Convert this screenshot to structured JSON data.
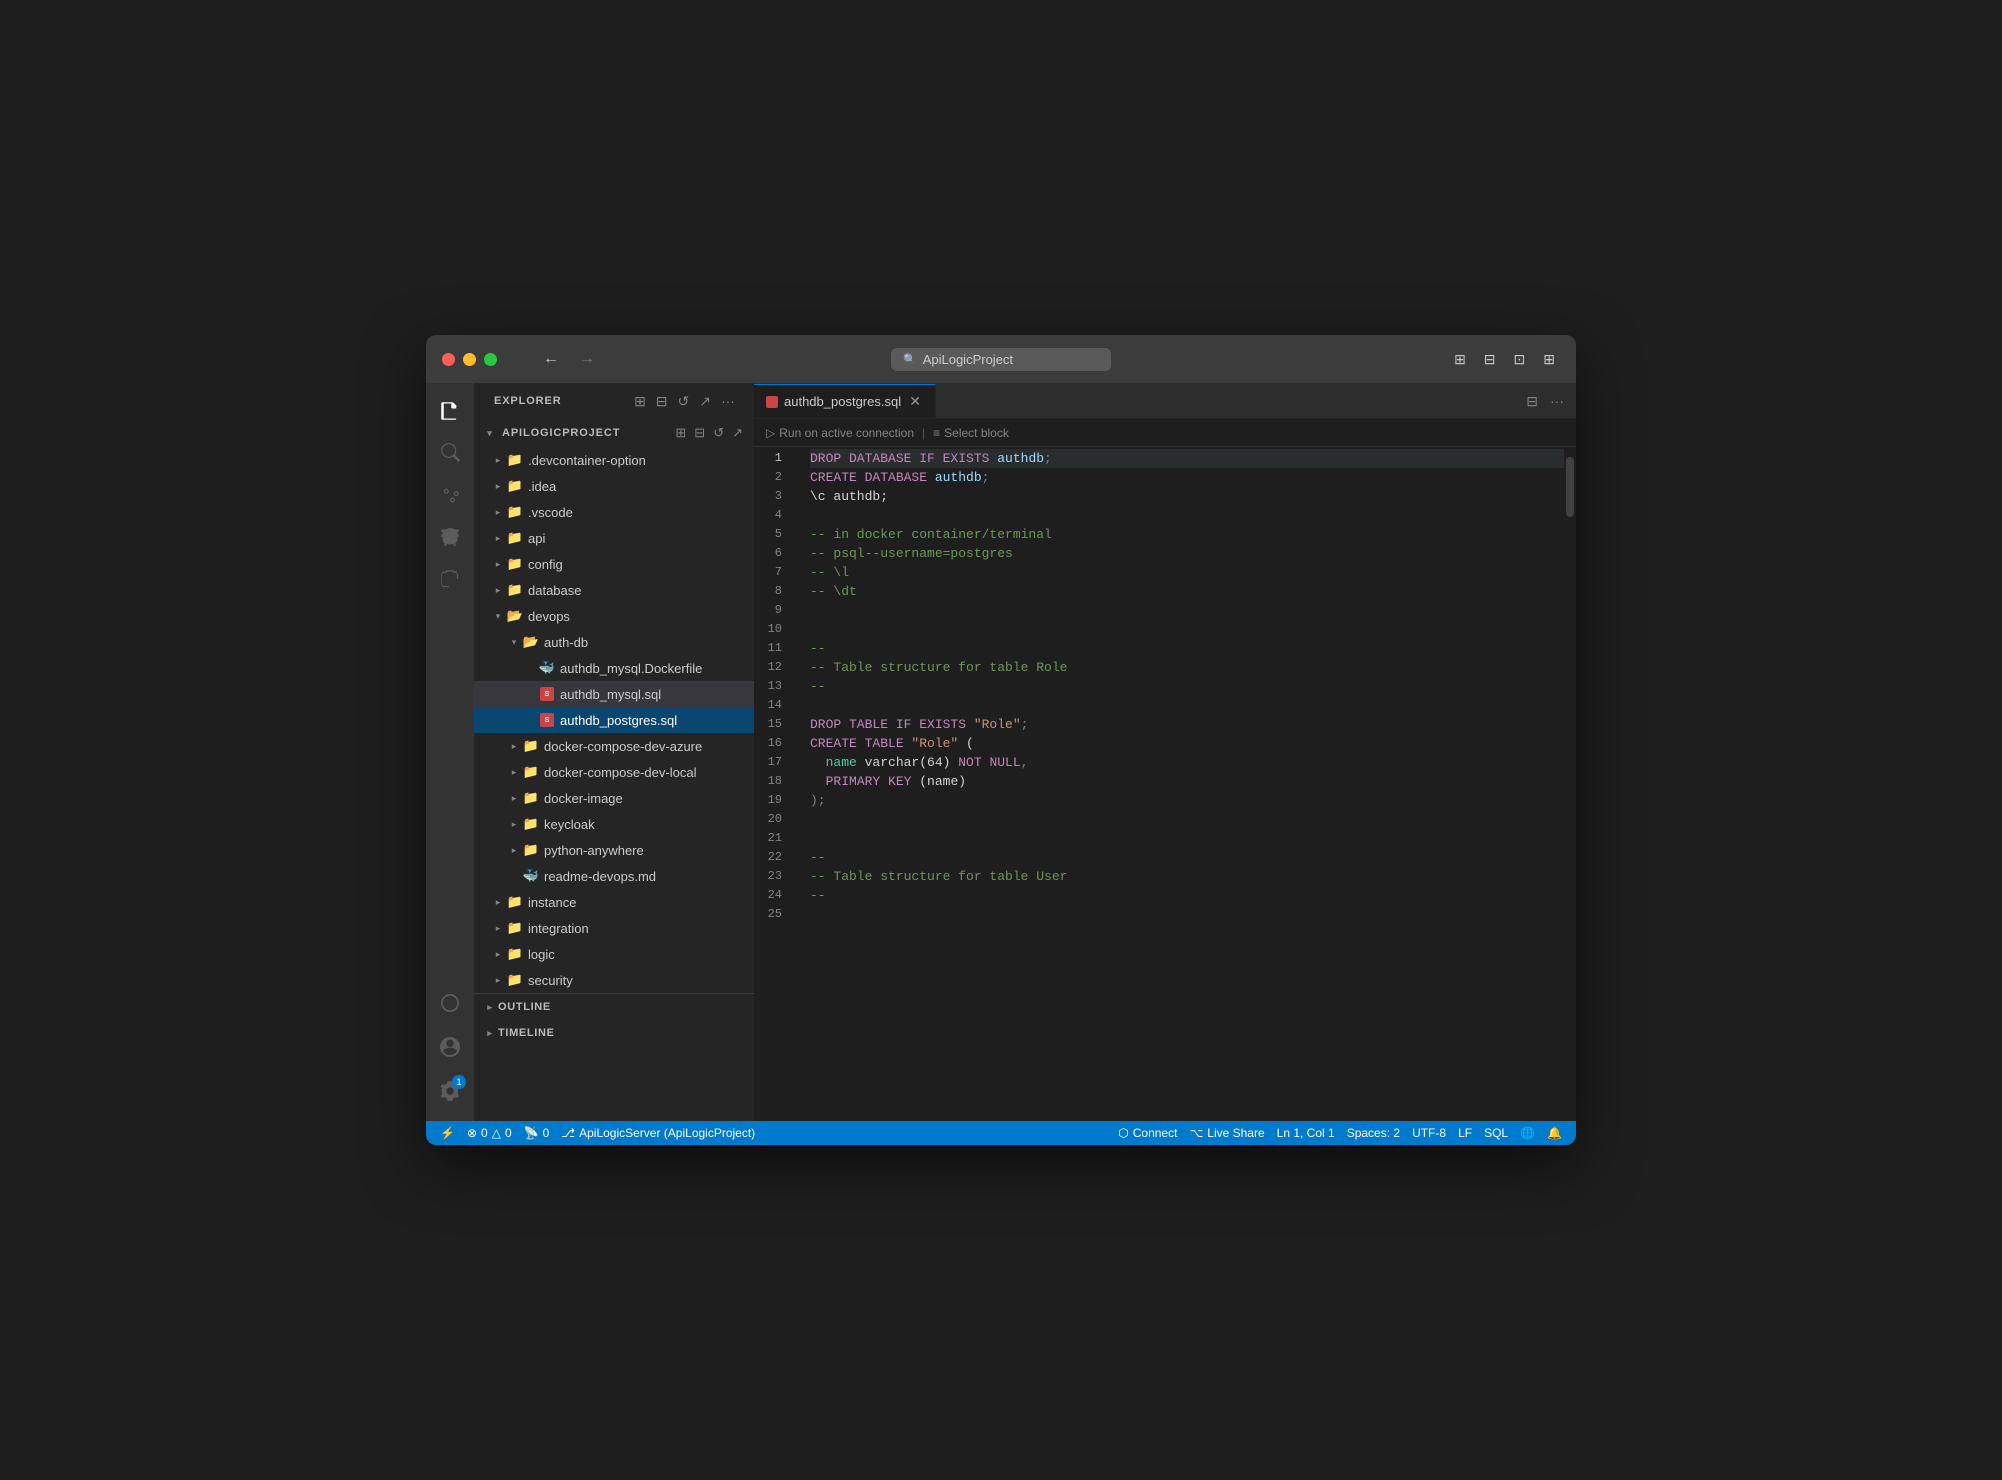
{
  "window": {
    "title": "ApiLogicProject"
  },
  "titlebar": {
    "back_label": "←",
    "search_placeholder": "ApiLogicProject",
    "icons": [
      "⊞",
      "⊟",
      "⊡",
      "⊞"
    ]
  },
  "activitybar": {
    "items": [
      {
        "id": "explorer",
        "icon": "📋",
        "label": "Explorer",
        "active": true
      },
      {
        "id": "git",
        "icon": "⎇",
        "label": "Source Control"
      },
      {
        "id": "run",
        "icon": "▷",
        "label": "Run and Debug"
      },
      {
        "id": "extensions",
        "icon": "⊞",
        "label": "Extensions"
      },
      {
        "id": "search",
        "icon": "🔍",
        "label": "Search"
      },
      {
        "id": "remote",
        "icon": "⚙",
        "label": "Remote Explorer"
      }
    ],
    "bottom_items": [
      {
        "id": "account",
        "icon": "👤",
        "label": "Account"
      },
      {
        "id": "settings",
        "icon": "⚙",
        "label": "Settings",
        "badge": "1"
      }
    ]
  },
  "sidebar": {
    "header": "Explorer",
    "actions": [
      "⊞",
      "⊟",
      "↺",
      "↗"
    ],
    "project": {
      "name": "APILOGICPROJECT",
      "actions": [
        "⊞",
        "⊟",
        "↺",
        "↗"
      ]
    },
    "tree": [
      {
        "indent": 0,
        "type": "folder",
        "open": false,
        "name": ".devcontainer-option"
      },
      {
        "indent": 0,
        "type": "folder",
        "open": false,
        "name": ".idea"
      },
      {
        "indent": 0,
        "type": "folder",
        "open": false,
        "name": ".vscode"
      },
      {
        "indent": 0,
        "type": "folder",
        "open": false,
        "name": "api"
      },
      {
        "indent": 0,
        "type": "folder",
        "open": false,
        "name": "config"
      },
      {
        "indent": 0,
        "type": "folder",
        "open": false,
        "name": "database"
      },
      {
        "indent": 0,
        "type": "folder",
        "open": true,
        "name": "devops"
      },
      {
        "indent": 1,
        "type": "folder",
        "open": true,
        "name": "auth-db"
      },
      {
        "indent": 2,
        "type": "file-docker",
        "name": "authdb_mysql.Dockerfile"
      },
      {
        "indent": 2,
        "type": "file-sql",
        "name": "authdb_mysql.sql",
        "selected_secondary": true
      },
      {
        "indent": 2,
        "type": "file-sql",
        "name": "authdb_postgres.sql",
        "selected": true
      },
      {
        "indent": 1,
        "type": "folder",
        "open": false,
        "name": "docker-compose-dev-azure"
      },
      {
        "indent": 1,
        "type": "folder",
        "open": false,
        "name": "docker-compose-dev-local"
      },
      {
        "indent": 1,
        "type": "folder",
        "open": false,
        "name": "docker-image"
      },
      {
        "indent": 1,
        "type": "folder",
        "open": false,
        "name": "keycloak"
      },
      {
        "indent": 1,
        "type": "folder",
        "open": false,
        "name": "python-anywhere"
      },
      {
        "indent": 1,
        "type": "file-md",
        "name": "readme-devops.md"
      },
      {
        "indent": 0,
        "type": "folder",
        "open": false,
        "name": "instance"
      },
      {
        "indent": 0,
        "type": "folder",
        "open": false,
        "name": "integration"
      },
      {
        "indent": 0,
        "type": "folder",
        "open": false,
        "name": "logic"
      },
      {
        "indent": 0,
        "type": "folder",
        "open": false,
        "name": "security"
      }
    ],
    "sections": [
      {
        "name": "OUTLINE"
      },
      {
        "name": "TIMELINE"
      }
    ]
  },
  "editor": {
    "tabs": [
      {
        "name": "authdb_postgres.sql",
        "active": true,
        "icon": "sql"
      }
    ],
    "toolbar": {
      "run_label": "Run on active connection",
      "select_label": "Select block"
    },
    "lines": [
      {
        "num": 1,
        "active": true,
        "tokens": [
          {
            "type": "kw",
            "text": "DROP DATABASE IF EXISTS "
          },
          {
            "type": "id",
            "text": "authdb"
          },
          {
            "type": "punc",
            "text": ";"
          }
        ]
      },
      {
        "num": 2,
        "tokens": [
          {
            "type": "kw",
            "text": "CREATE DATABASE "
          },
          {
            "type": "id",
            "text": "authdb"
          },
          {
            "type": "punc",
            "text": ";"
          }
        ]
      },
      {
        "num": 3,
        "tokens": [
          {
            "type": "plain",
            "text": "\\c authdb;"
          }
        ]
      },
      {
        "num": 4,
        "tokens": []
      },
      {
        "num": 5,
        "tokens": [
          {
            "type": "cmt",
            "text": "-- in docker container/terminal"
          }
        ]
      },
      {
        "num": 6,
        "tokens": [
          {
            "type": "cmt",
            "text": "-- psql--username=postgres"
          }
        ]
      },
      {
        "num": 7,
        "tokens": [
          {
            "type": "cmt",
            "text": "-- \\l"
          }
        ]
      },
      {
        "num": 8,
        "tokens": [
          {
            "type": "cmt",
            "text": "-- \\dt"
          }
        ]
      },
      {
        "num": 9,
        "tokens": []
      },
      {
        "num": 10,
        "tokens": []
      },
      {
        "num": 11,
        "tokens": [
          {
            "type": "cmt",
            "text": "--"
          }
        ]
      },
      {
        "num": 12,
        "tokens": [
          {
            "type": "cmt",
            "text": "-- Table structure for table Role"
          }
        ]
      },
      {
        "num": 13,
        "tokens": [
          {
            "type": "cmt",
            "text": "--"
          }
        ]
      },
      {
        "num": 14,
        "tokens": []
      },
      {
        "num": 15,
        "tokens": [
          {
            "type": "kw",
            "text": "DROP TABLE IF EXISTS "
          },
          {
            "type": "str",
            "text": "\"Role\""
          },
          {
            "type": "punc",
            "text": ";"
          }
        ]
      },
      {
        "num": 16,
        "tokens": [
          {
            "type": "kw",
            "text": "CREATE TABLE "
          },
          {
            "type": "str",
            "text": "\"Role\""
          },
          {
            "type": "punc",
            "text": " ("
          }
        ]
      },
      {
        "num": 17,
        "tokens": [
          {
            "type": "plain",
            "text": "  "
          },
          {
            "type": "id2",
            "text": "name"
          },
          {
            "type": "plain",
            "text": " varchar(64) "
          },
          {
            "type": "kw",
            "text": "NOT NULL"
          },
          {
            "type": "punc",
            "text": ","
          }
        ]
      },
      {
        "num": 18,
        "tokens": [
          {
            "type": "plain",
            "text": "  "
          },
          {
            "type": "kw",
            "text": "PRIMARY KEY"
          },
          {
            "type": "plain",
            "text": " (name)"
          }
        ]
      },
      {
        "num": 19,
        "tokens": [
          {
            "type": "punc",
            "text": ");"
          }
        ]
      },
      {
        "num": 20,
        "tokens": []
      },
      {
        "num": 21,
        "tokens": []
      },
      {
        "num": 22,
        "tokens": [
          {
            "type": "cmt",
            "text": "--"
          }
        ]
      },
      {
        "num": 23,
        "tokens": [
          {
            "type": "cmt",
            "text": "-- Table structure for table User"
          }
        ]
      },
      {
        "num": 24,
        "tokens": [
          {
            "type": "cmt",
            "text": "--"
          }
        ]
      },
      {
        "num": 25,
        "tokens": []
      }
    ]
  },
  "statusbar": {
    "items_left": [
      {
        "icon": "⚡",
        "text": ""
      },
      {
        "icon": "⊗",
        "text": "0"
      },
      {
        "icon": "△",
        "text": "0"
      },
      {
        "icon": "📡",
        "text": "0"
      },
      {
        "icon": "",
        "text": "ApiLogicServer (ApiLogicProject)"
      }
    ],
    "items_right": [
      {
        "text": "Connect"
      },
      {
        "icon": "⌥",
        "text": "Live Share"
      },
      {
        "text": "Ln 1, Col 1"
      },
      {
        "text": "Spaces: 2"
      },
      {
        "text": "UTF-8"
      },
      {
        "text": "LF"
      },
      {
        "text": "SQL"
      },
      {
        "icon": "🌐",
        "text": ""
      },
      {
        "icon": "🔔",
        "text": ""
      }
    ]
  }
}
